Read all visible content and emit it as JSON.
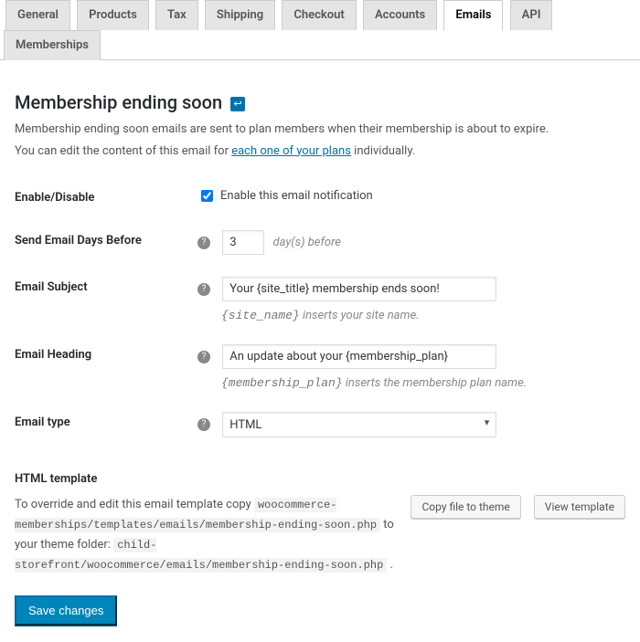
{
  "tabs": [
    {
      "label": "General"
    },
    {
      "label": "Products"
    },
    {
      "label": "Tax"
    },
    {
      "label": "Shipping"
    },
    {
      "label": "Checkout"
    },
    {
      "label": "Accounts"
    },
    {
      "label": "Emails",
      "active": true
    },
    {
      "label": "API"
    },
    {
      "label": "Memberships"
    }
  ],
  "page_title": "Membership ending soon",
  "back_icon_glyph": "↩",
  "description": {
    "line1": "Membership ending soon emails are sent to plan members when their membership is about to expire.",
    "line2_before": "You can edit the content of this email for ",
    "line2_link": "each one of your plans",
    "line2_after": " individually."
  },
  "fields": {
    "enable": {
      "label": "Enable/Disable",
      "checkbox_label": "Enable this email notification",
      "checked": true
    },
    "days_before": {
      "label": "Send Email Days Before",
      "value": "3",
      "suffix": "day(s) before"
    },
    "subject": {
      "label": "Email Subject",
      "value": "Your {site_title} membership ends soon!",
      "hint_code": "{site_name}",
      "hint_text": " inserts your site name."
    },
    "heading": {
      "label": "Email Heading",
      "value": "An update about your {membership_plan}",
      "hint_code": "{membership_plan}",
      "hint_text": " inserts the membership plan name."
    },
    "email_type": {
      "label": "Email type",
      "value": "HTML"
    }
  },
  "template": {
    "heading": "HTML template",
    "text_before": "To override and edit this email template copy ",
    "path1": "woocommerce-memberships/templates/emails/membership-ending-soon.php",
    "text_middle": " to your theme folder: ",
    "path2": "child-storefront/woocommerce/emails/membership-ending-soon.php",
    "text_after": " .",
    "copy_button": "Copy file to theme",
    "view_button": "View template"
  },
  "save_button": "Save changes"
}
